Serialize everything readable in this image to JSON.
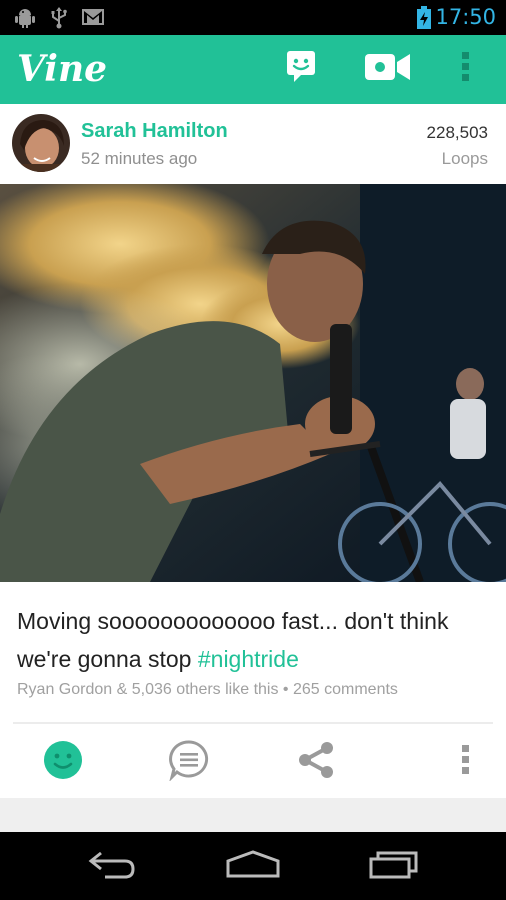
{
  "status_bar": {
    "time": "17:50",
    "icons": [
      "android-debug-icon",
      "usb-icon",
      "gmail-icon",
      "battery-charging-icon"
    ]
  },
  "action_bar": {
    "logo_text": "Vine",
    "icons": [
      "chat-face-icon",
      "video-camera-icon",
      "overflow-menu-icon"
    ]
  },
  "post": {
    "author": "Sarah Hamilton",
    "time_ago": "52 minutes ago",
    "loops_count": "228,503",
    "loops_label": "Loops",
    "caption_text": "Moving sooooooooooooo fast... don't think we're gonna stop ",
    "hashtag": "#nightride",
    "likes_line": "Ryan Gordon & 5,036 others like this • 265 comments"
  },
  "actions": [
    "like-icon",
    "comment-icon",
    "share-icon",
    "more-icon"
  ],
  "nav_bar": [
    "back-icon",
    "home-icon",
    "recents-icon"
  ],
  "colors": {
    "accent": "#21c197",
    "status_time": "#33b5e5"
  }
}
